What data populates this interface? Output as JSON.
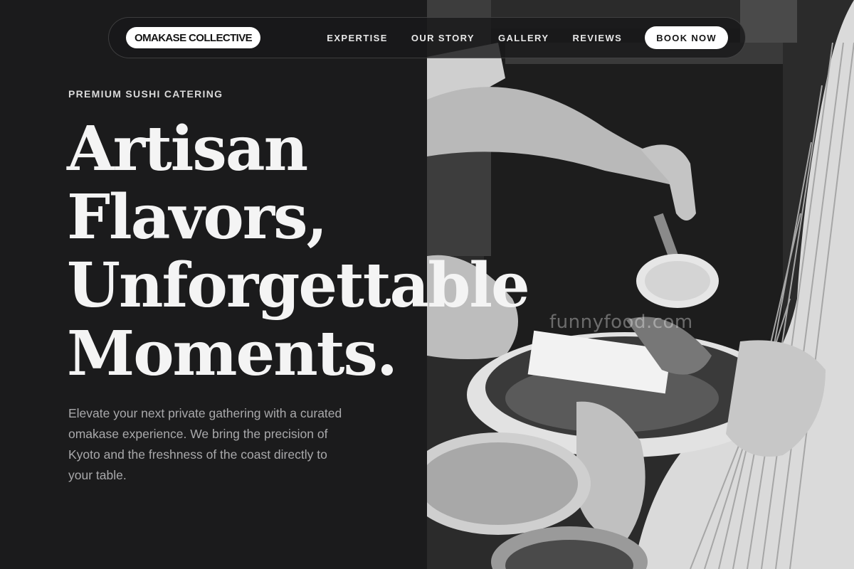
{
  "nav": {
    "brand": "OMAKASE COLLECTIVE",
    "links": [
      "EXPERTISE",
      "OUR STORY",
      "GALLERY",
      "REVIEWS"
    ],
    "cta": "BOOK NOW"
  },
  "hero": {
    "eyebrow": "PREMIUM SUSHI CATERING",
    "headline": [
      "Artisan",
      "Flavors,",
      "Unforgettable",
      "Moments."
    ],
    "intro": "Elevate your next private gathering with a curated omakase experience. We bring the precision of Kyoto and the freshness of the coast directly to your table."
  },
  "photo": {
    "watermark": "funnyfood.com"
  },
  "colors": {
    "background": "#1b1b1c",
    "text": "#f4f4f4",
    "muted": "#a9a9ab",
    "button": "#ffffff"
  }
}
